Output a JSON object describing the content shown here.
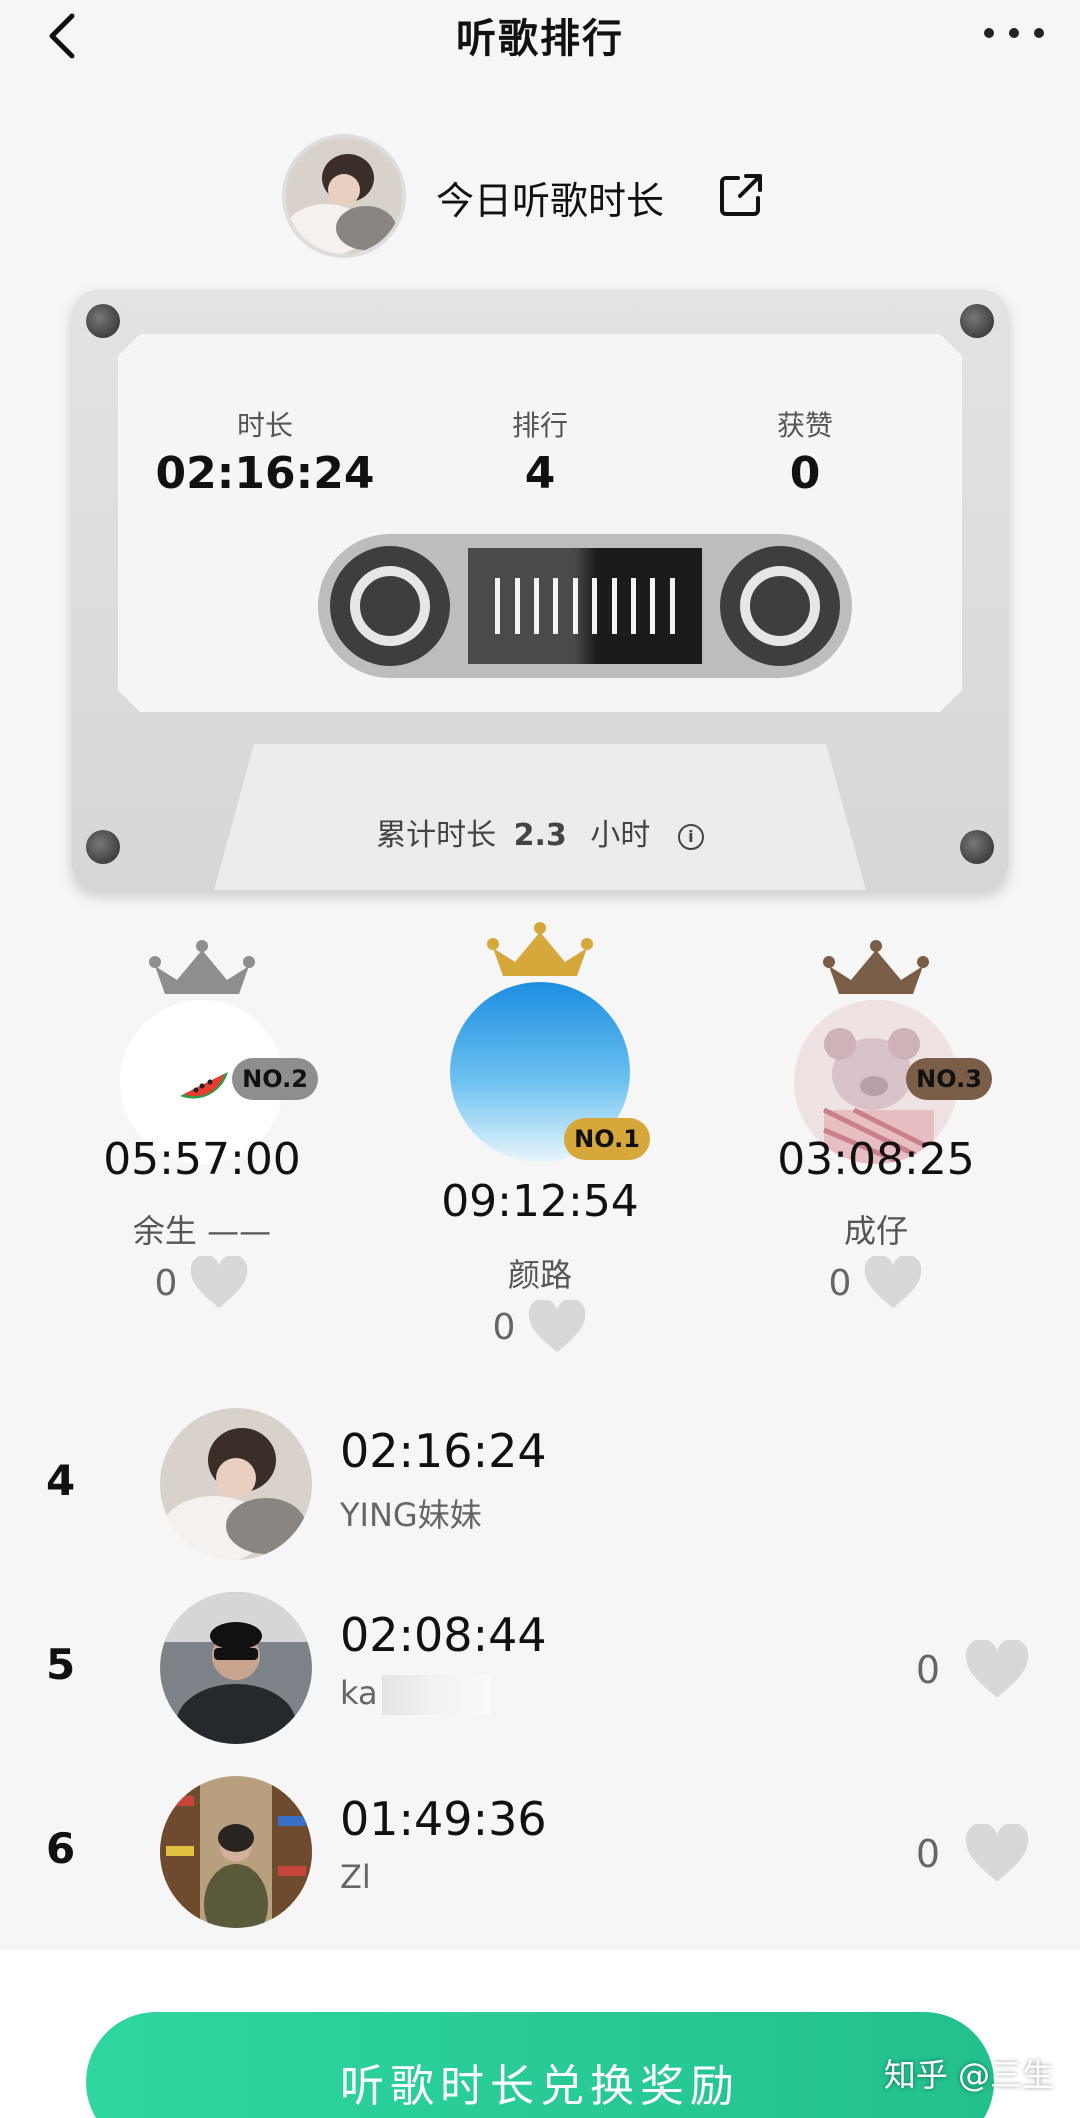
{
  "header": {
    "title": "听歌排行",
    "back_icon": "chevron-left-icon",
    "more_icon": "more-dots-icon"
  },
  "profile": {
    "label": "今日听歌时长",
    "share_icon": "share-external-icon"
  },
  "cassette": {
    "stats": [
      {
        "label": "时长",
        "value": "02:16:24"
      },
      {
        "label": "排行",
        "value": "4"
      },
      {
        "label": "获赞",
        "value": "0"
      }
    ],
    "total_prefix": "累计时长",
    "total_value": "2.3",
    "total_unit": "小时",
    "info_icon": "i"
  },
  "podium": [
    {
      "rank_tag": "NO.2",
      "time": "05:57:00",
      "name": "余生 ——",
      "likes": "0",
      "crown_color": "#8e8e8e",
      "tag_color": "#8e8e8e"
    },
    {
      "rank_tag": "NO.1",
      "time": "09:12:54",
      "name": "颜路",
      "likes": "0",
      "crown_color": "#d6a73a",
      "tag_color": "#d6a73a"
    },
    {
      "rank_tag": "NO.3",
      "time": "03:08:25",
      "name": "成仔",
      "likes": "0",
      "crown_color": "#7a5e48",
      "tag_color": "#7a5e48"
    }
  ],
  "list": [
    {
      "rank": "4",
      "time": "02:16:24",
      "name": "YING妹妹",
      "likes": ""
    },
    {
      "rank": "5",
      "time": "02:08:44",
      "name": "ka",
      "likes": "0"
    },
    {
      "rank": "6",
      "time": "01:49:36",
      "name": "Zl",
      "likes": "0"
    }
  ],
  "cta": {
    "label": "听歌时长兑换奖励"
  },
  "watermark": "知乎 @三生",
  "colors": {
    "accent": "#22c08c",
    "heart": "#d8d8d8"
  }
}
